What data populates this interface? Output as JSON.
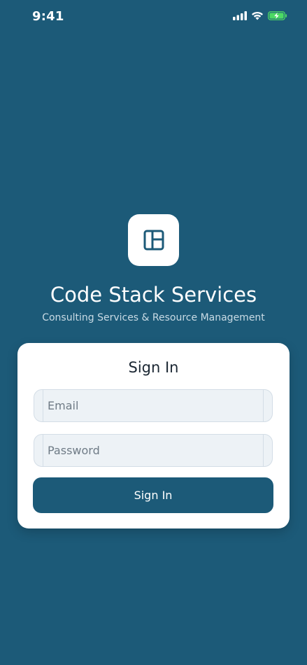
{
  "status_bar": {
    "time": "9:41",
    "icons": [
      "cellular-signal-icon",
      "wifi-icon",
      "battery-charging-icon"
    ]
  },
  "app": {
    "logo_icon": "layout-panel-icon",
    "title": "Code Stack Services",
    "subtitle": "Consulting Services & Resource Management"
  },
  "sign_in_card": {
    "title": "Sign In",
    "email_placeholder": "Email",
    "email_value": "",
    "password_placeholder": "Password",
    "password_value": "",
    "submit_label": "Sign In"
  },
  "colors": {
    "background": "#1c5a78",
    "accent": "#1c5a78",
    "battery_green": "#4cd964"
  }
}
